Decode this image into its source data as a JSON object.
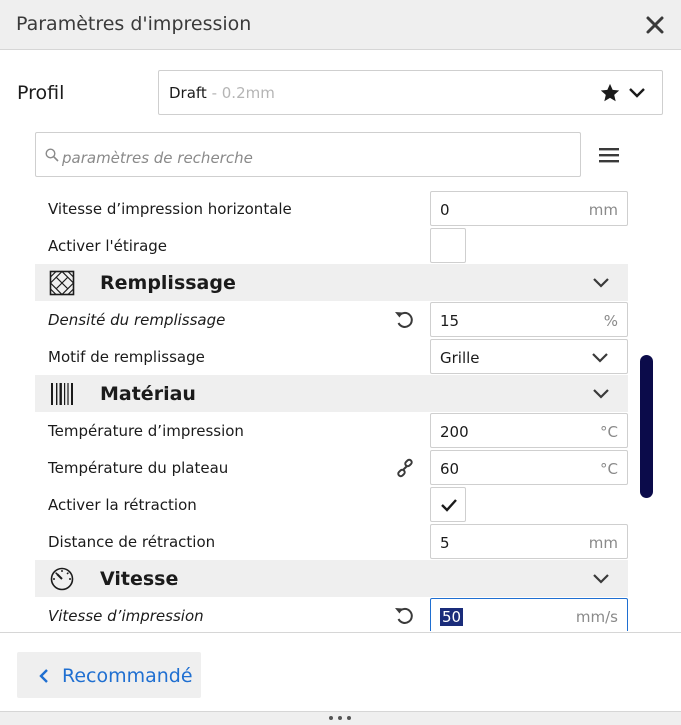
{
  "window": {
    "title": "Paramètres d'impression"
  },
  "profile": {
    "label": "Profil",
    "name": "Draft",
    "sub": " - 0.2mm"
  },
  "search": {
    "placeholder": "paramètres de recherche"
  },
  "settings": {
    "h_speed": {
      "label": "Vitesse d’impression horizontale",
      "value": "0",
      "unit": "mm"
    },
    "ironing": {
      "label": "Activer l'étirage",
      "checked": false
    },
    "infill": {
      "title": "Remplissage"
    },
    "infill_density": {
      "label": "Densité du remplissage",
      "value": "15",
      "unit": "%"
    },
    "infill_pattern": {
      "label": "Motif de remplissage",
      "value": "Grille"
    },
    "material": {
      "title": "Matériau"
    },
    "print_temp": {
      "label": "Température d’impression",
      "value": "200",
      "unit": "°C"
    },
    "bed_temp": {
      "label": "Température du plateau",
      "value": "60",
      "unit": "°C"
    },
    "retraction": {
      "label": "Activer la rétraction",
      "checked": true
    },
    "retraction_distance": {
      "label": "Distance de rétraction",
      "value": "5",
      "unit": "mm"
    },
    "speed": {
      "title": "Vitesse"
    },
    "print_speed": {
      "label": "Vitesse d’impression",
      "value": "50",
      "unit": "mm/s"
    }
  },
  "footer": {
    "recommended_label": "Recommandé"
  },
  "colors": {
    "accent": "#1f6fd1",
    "scrollbar": "#0b0b4a",
    "selection": "#1a2c7a",
    "panel_gray": "#efefef"
  }
}
